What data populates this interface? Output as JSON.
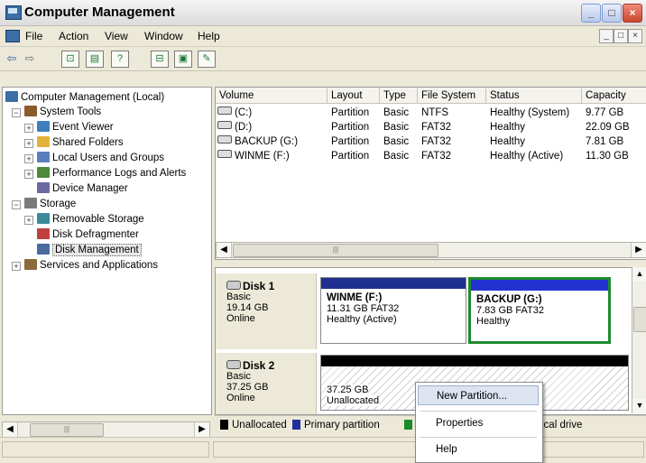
{
  "window": {
    "title": "Computer Management",
    "buttons": {
      "minimize": "_",
      "maximize": "□",
      "close": "×"
    }
  },
  "menubar": {
    "items": [
      "File",
      "Action",
      "View",
      "Window",
      "Help"
    ],
    "mdi_buttons": [
      "_",
      "□",
      "×"
    ]
  },
  "toolbar": {
    "buttons": [
      {
        "icon": "back-arrow-icon",
        "glyph": "⇦"
      },
      {
        "icon": "forward-arrow-icon",
        "glyph": "⇨"
      },
      {
        "icon": "up-folder-icon",
        "glyph": "⊡"
      },
      {
        "icon": "show-hide-tree-icon",
        "glyph": "▤"
      },
      {
        "icon": "help-icon",
        "glyph": "?"
      },
      {
        "icon": "export-icon",
        "glyph": "⊟"
      },
      {
        "icon": "properties-icon",
        "glyph": "▣"
      },
      {
        "icon": "wizard-icon",
        "glyph": "✎"
      }
    ]
  },
  "tree": {
    "items": [
      {
        "label": "Computer Management (Local)",
        "icon": "computer-icon",
        "color": "#3a6ea5"
      },
      {
        "label": "System Tools",
        "icon": "tools-icon",
        "color": "#8a5a2a",
        "expander": "−"
      },
      {
        "label": "Event Viewer",
        "icon": "event-viewer-icon",
        "color": "#3f7fbf",
        "expander": "+"
      },
      {
        "label": "Shared Folders",
        "icon": "shared-folders-icon",
        "color": "#e3b23c",
        "expander": "+"
      },
      {
        "label": "Local Users and Groups",
        "icon": "users-icon",
        "color": "#5a7fbf",
        "expander": "+"
      },
      {
        "label": "Performance Logs and Alerts",
        "icon": "performance-icon",
        "color": "#4a8a3a",
        "expander": "+"
      },
      {
        "label": "Device Manager",
        "icon": "device-manager-icon",
        "color": "#6a6aa0"
      },
      {
        "label": "Storage",
        "icon": "storage-icon",
        "color": "#7a7a7a",
        "expander": "−"
      },
      {
        "label": "Removable Storage",
        "icon": "removable-storage-icon",
        "color": "#3a8a9a",
        "expander": "+"
      },
      {
        "label": "Disk Defragmenter",
        "icon": "defrag-icon",
        "color": "#c04040"
      },
      {
        "label": "Disk Management",
        "icon": "disk-management-icon",
        "color": "#4a6aa0",
        "selected": true
      },
      {
        "label": "Services and Applications",
        "icon": "services-icon",
        "color": "#8a6a3a",
        "expander": "+"
      }
    ]
  },
  "volumes": {
    "columns": [
      "Volume",
      "Layout",
      "Type",
      "File System",
      "Status",
      "Capacity"
    ],
    "rows": [
      {
        "volume": "(C:)",
        "layout": "Partition",
        "type": "Basic",
        "fs": "NTFS",
        "status": "Healthy (System)",
        "capacity": "9.77 GB"
      },
      {
        "volume": "(D:)",
        "layout": "Partition",
        "type": "Basic",
        "fs": "FAT32",
        "status": "Healthy",
        "capacity": "22.09 GB"
      },
      {
        "volume": "BACKUP (G:)",
        "layout": "Partition",
        "type": "Basic",
        "fs": "FAT32",
        "status": "Healthy",
        "capacity": "7.81 GB"
      },
      {
        "volume": "WINME (F:)",
        "layout": "Partition",
        "type": "Basic",
        "fs": "FAT32",
        "status": "Healthy (Active)",
        "capacity": "11.30 GB"
      }
    ]
  },
  "disks": [
    {
      "name": "Disk 1",
      "type": "Basic",
      "size": "19.14 GB",
      "state": "Online",
      "partitions": [
        {
          "name": "WINME  (F:)",
          "size": "11.31 GB FAT32",
          "status": "Healthy (Active)",
          "bar_color": "#1f2f8f"
        },
        {
          "name": "BACKUP  (G:)",
          "size": "7.83 GB FAT32",
          "status": "Healthy",
          "bar_color": "#2433d0",
          "selected": true
        }
      ]
    },
    {
      "name": "Disk 2",
      "type": "Basic",
      "size": "37.25 GB",
      "state": "Online",
      "partitions": [
        {
          "name": "",
          "size": "37.25 GB",
          "status": "Unallocated",
          "bar_color": "#000000"
        }
      ]
    }
  ],
  "legend": [
    {
      "label": "Unallocated",
      "color": "#000000"
    },
    {
      "label": "Primary partition",
      "color": "#1f2fa0"
    },
    {
      "label": "",
      "color": "#1a8a2a"
    },
    {
      "label": "ical drive",
      "color": ""
    }
  ],
  "context_menu": {
    "items": [
      "New Partition...",
      "Properties",
      "Help"
    ],
    "highlighted": 0
  },
  "colors": {
    "selection_green": "#1e8a2e",
    "partition_blue": "#1f2f8f"
  }
}
